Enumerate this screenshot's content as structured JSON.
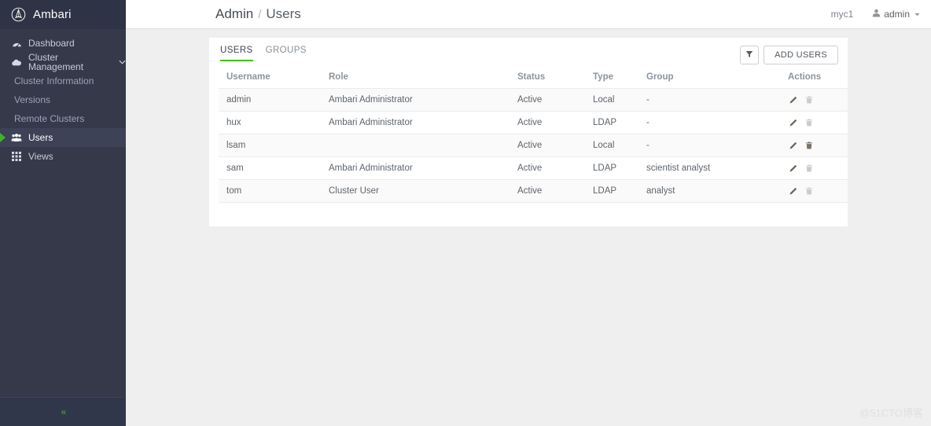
{
  "brand": {
    "title": "Ambari",
    "logo_icon": "ambari-logo-icon"
  },
  "sidebar": {
    "items": [
      {
        "label": "Dashboard",
        "icon": "dashboard-gauge-icon",
        "type": "item",
        "active": false
      },
      {
        "label": "Cluster Management",
        "icon": "cloud-icon",
        "type": "item",
        "active": false,
        "caret": "⌄"
      },
      {
        "label": "Cluster Information",
        "type": "sub"
      },
      {
        "label": "Versions",
        "type": "sub"
      },
      {
        "label": "Remote Clusters",
        "type": "sub"
      },
      {
        "label": "Users",
        "icon": "users-group-icon",
        "type": "item",
        "active": true
      },
      {
        "label": "Views",
        "icon": "grid-views-icon",
        "type": "item",
        "active": false
      }
    ],
    "collapse_glyph": "«"
  },
  "topbar": {
    "breadcrumb": {
      "parent": "Admin",
      "separator": "/",
      "current": "Users"
    },
    "cluster_name": "myc1",
    "user": {
      "name": "admin",
      "icon": "user-person-icon",
      "caret": "▼"
    }
  },
  "card": {
    "tabs": [
      {
        "label": "USERS",
        "active": true
      },
      {
        "label": "GROUPS",
        "active": false
      }
    ],
    "filter_button": {
      "label": "",
      "icon": "filter-funnel-icon"
    },
    "add_button": {
      "label": "ADD USERS"
    },
    "table": {
      "columns": [
        "Username",
        "Role",
        "Status",
        "Type",
        "Group",
        "Actions"
      ],
      "rows": [
        {
          "username": "admin",
          "role": "Ambari Administrator",
          "status": "Active",
          "type": "Local",
          "group": "-",
          "edit_icon": "pencil-edit-icon",
          "delete_icon": "trash-delete-icon",
          "delete_enabled": false
        },
        {
          "username": "hux",
          "role": "Ambari Administrator",
          "status": "Active",
          "type": "LDAP",
          "group": "-",
          "edit_icon": "pencil-edit-icon",
          "delete_icon": "trash-delete-icon",
          "delete_enabled": false
        },
        {
          "username": "lsam",
          "role": "",
          "status": "Active",
          "type": "Local",
          "group": "-",
          "edit_icon": "pencil-edit-icon",
          "delete_icon": "trash-delete-icon",
          "delete_enabled": true
        },
        {
          "username": "sam",
          "role": "Ambari Administrator",
          "status": "Active",
          "type": "LDAP",
          "group": "scientist analyst",
          "edit_icon": "pencil-edit-icon",
          "delete_icon": "trash-delete-icon",
          "delete_enabled": false
        },
        {
          "username": "tom",
          "role": "Cluster User",
          "status": "Active",
          "type": "LDAP",
          "group": "analyst",
          "edit_icon": "pencil-edit-icon",
          "delete_icon": "trash-delete-icon",
          "delete_enabled": false
        }
      ]
    }
  },
  "watermark": {
    "text": "@51CTO博客"
  },
  "colors": {
    "sidebar_bg": "#35394a",
    "sidebar_brand_bg": "#2e3446",
    "accent_green": "#41c300",
    "active_item_bg": "#3d4256",
    "page_bg": "#efefef"
  }
}
